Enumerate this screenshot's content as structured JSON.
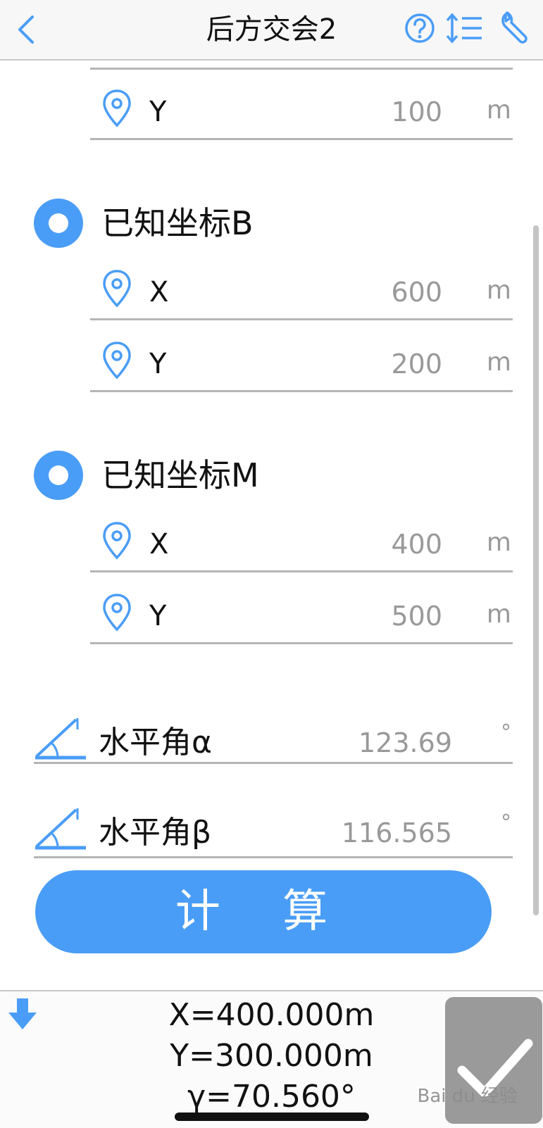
{
  "header": {
    "title": "后方交会2",
    "icons": [
      "back-chevron-icon",
      "help-icon",
      "sort-lines-icon",
      "wrench-icon"
    ],
    "accent": "#4a9df6"
  },
  "point_a": {
    "y": {
      "label": "Y",
      "value": "100",
      "unit": "m"
    }
  },
  "point_b": {
    "title": "已知坐标B",
    "x": {
      "label": "X",
      "value": "600",
      "unit": "m"
    },
    "y": {
      "label": "Y",
      "value": "200",
      "unit": "m"
    }
  },
  "point_m": {
    "title": "已知坐标M",
    "x": {
      "label": "X",
      "value": "400",
      "unit": "m"
    },
    "y": {
      "label": "Y",
      "value": "500",
      "unit": "m"
    }
  },
  "angles": [
    {
      "label": "水平角α",
      "value": "123.69",
      "unit": "°"
    },
    {
      "label": "水平角β",
      "value": "116.565",
      "unit": "°"
    }
  ],
  "calc_button": "计 算",
  "result": {
    "x": "X=400.000m",
    "y": "Y=300.000m",
    "gamma": "γ=70.560°"
  },
  "watermark": "Bai du 经验"
}
